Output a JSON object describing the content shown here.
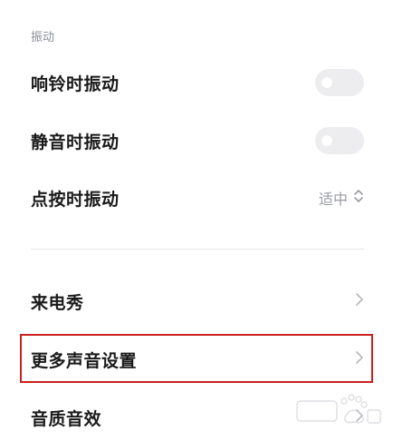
{
  "section": {
    "header": "振动"
  },
  "rows": {
    "ring_vibrate": {
      "label": "响铃时振动",
      "toggle_on": false
    },
    "silent_vibrate": {
      "label": "静音时振动",
      "toggle_on": false
    },
    "tap_vibrate": {
      "label": "点按时振动",
      "value": "适中"
    },
    "caller_show": {
      "label": "来电秀"
    },
    "more_sound": {
      "label": "更多声音设置"
    },
    "sound_quality": {
      "label": "音质音效"
    }
  },
  "colors": {
    "highlight": "#cc1f1f",
    "toggle_off": "#ededef",
    "secondary_text": "#9a9ca3"
  },
  "icons": {
    "updown": "updown-chevron-icon",
    "chevron": "chevron-right-icon",
    "watermark": "baidu-watermark-icon"
  }
}
